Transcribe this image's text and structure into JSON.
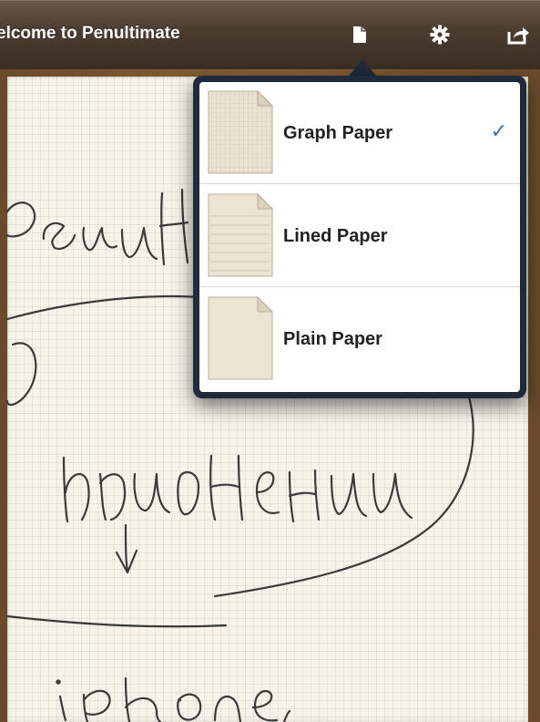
{
  "toolbar": {
    "title": "elcome to Penultimate",
    "icons": [
      "page-icon",
      "gear-icon",
      "share-icon"
    ]
  },
  "paper_menu": {
    "items": [
      {
        "label": "Graph Paper",
        "style": "graph",
        "selected": true
      },
      {
        "label": "Lined Paper",
        "style": "lined",
        "selected": false
      },
      {
        "label": "Plain Paper",
        "style": "plain",
        "selected": false
      }
    ],
    "checkmark": "✓",
    "accent_color": "#3d6fb6"
  }
}
